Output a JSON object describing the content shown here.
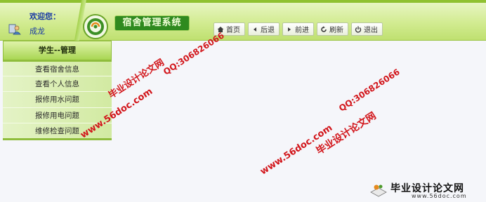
{
  "header": {
    "welcome": "欢迎您：",
    "username": "成龙",
    "app_title": "宿舍管理系统"
  },
  "navbar": [
    {
      "label": "首页",
      "icon": "home-icon"
    },
    {
      "label": "后退",
      "icon": "back-icon"
    },
    {
      "label": "前进",
      "icon": "forward-icon"
    },
    {
      "label": "刷新",
      "icon": "refresh-icon"
    },
    {
      "label": "退出",
      "icon": "power-icon"
    }
  ],
  "sidebar": {
    "title": "学生--管理",
    "items": [
      {
        "label": "查看宿舍信息"
      },
      {
        "label": "查看个人信息"
      },
      {
        "label": "报修用水问题"
      },
      {
        "label": "报修用电问题"
      },
      {
        "label": "维修检查问题"
      }
    ]
  },
  "watermark": {
    "cn": "毕业设计论文网",
    "url": "www.56doc.com",
    "qq": "QQ:306826066",
    "logo_text": "毕业设计论文网",
    "logo_url": "www.56doc.com"
  },
  "colors": {
    "accent_green": "#8fc130",
    "title_bg": "#2f8a1f",
    "watermark_red": "#d2161b",
    "user_text": "#1a3aa5"
  }
}
